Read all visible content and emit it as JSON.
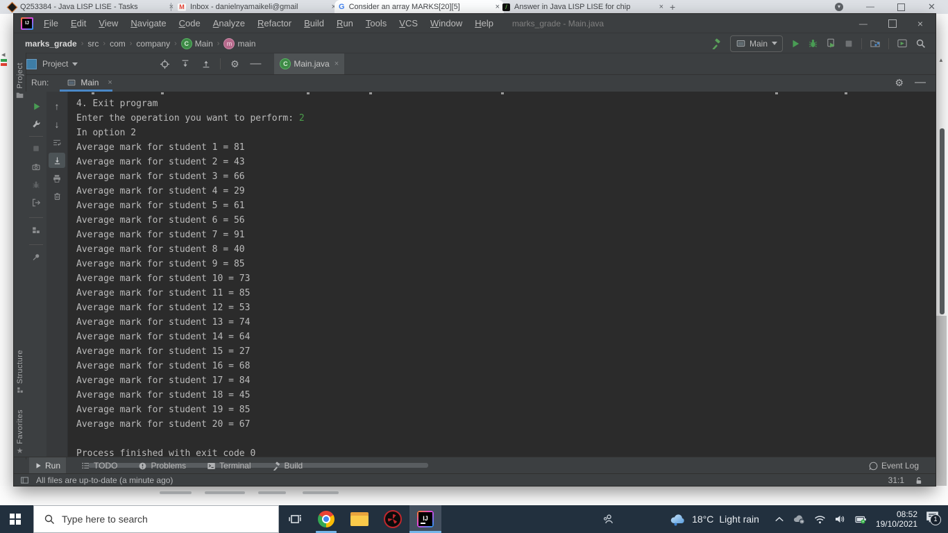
{
  "colors": {
    "accent_blue": "#4A88C7",
    "run_green": "#499C54",
    "console_input_green": "#4B9E4B",
    "ide_chrome": "#3C3F41",
    "console_bg": "#2B2B2B",
    "taskbar_bg": "#22303E"
  },
  "browser": {
    "tabs": [
      {
        "title": "Q253384 - Java LISP LISE - Tasks"
      },
      {
        "title": "Inbox - danielnyamaikeli@gmail"
      },
      {
        "title": "Consider an array MARKS[20][5]"
      },
      {
        "title": "Answer in Java LISP LISE for chip"
      }
    ],
    "close_glyph": "×",
    "new_tab_glyph": "+"
  },
  "ide": {
    "window_title": "marks_grade - Main.java",
    "menu_items": [
      "File",
      "Edit",
      "View",
      "Navigate",
      "Code",
      "Analyze",
      "Refactor",
      "Build",
      "Run",
      "Tools",
      "VCS",
      "Window",
      "Help"
    ],
    "breadcrumbs": {
      "project": "marks_grade",
      "items": [
        "src",
        "com",
        "company"
      ],
      "class_name": "Main",
      "method_name": "main"
    },
    "toolbar": {
      "run_config": "Main"
    },
    "project_panel": {
      "label": "Project"
    },
    "editor_tabs": [
      {
        "label": "Main.java"
      }
    ],
    "left_stripe": {
      "project": "Project",
      "structure": "Structure",
      "favorites": "Favorites"
    },
    "run_panel": {
      "label": "Run:",
      "tab": "Main",
      "console_lines": [
        [
          {
            "t": "4. Exit program"
          }
        ],
        [
          {
            "t": "Enter the operation you want to perform: "
          },
          {
            "t": "2",
            "c": "input"
          }
        ],
        [
          {
            "t": "In option 2"
          }
        ],
        [
          {
            "t": "Average mark for student 1 = 81"
          }
        ],
        [
          {
            "t": "Average mark for student 2 = 43"
          }
        ],
        [
          {
            "t": "Average mark for student 3 = 66"
          }
        ],
        [
          {
            "t": "Average mark for student 4 = 29"
          }
        ],
        [
          {
            "t": "Average mark for student 5 = 61"
          }
        ],
        [
          {
            "t": "Average mark for student 6 = 56"
          }
        ],
        [
          {
            "t": "Average mark for student 7 = 91"
          }
        ],
        [
          {
            "t": "Average mark for student 8 = 40"
          }
        ],
        [
          {
            "t": "Average mark for student 9 = 85"
          }
        ],
        [
          {
            "t": "Average mark for student 10 = 73"
          }
        ],
        [
          {
            "t": "Average mark for student 11 = 85"
          }
        ],
        [
          {
            "t": "Average mark for student 12 = 53"
          }
        ],
        [
          {
            "t": "Average mark for student 13 = 74"
          }
        ],
        [
          {
            "t": "Average mark for student 14 = 64"
          }
        ],
        [
          {
            "t": "Average mark for student 15 = 27"
          }
        ],
        [
          {
            "t": "Average mark for student 16 = 68"
          }
        ],
        [
          {
            "t": "Average mark for student 17 = 84"
          }
        ],
        [
          {
            "t": "Average mark for student 18 = 45"
          }
        ],
        [
          {
            "t": "Average mark for student 19 = 85"
          }
        ],
        [
          {
            "t": "Average mark for student 20 = 67"
          }
        ],
        [
          {
            "t": ""
          }
        ],
        [
          {
            "t": "Process finished with exit code 0"
          }
        ]
      ]
    },
    "tool_buttons": [
      "Run",
      "TODO",
      "Problems",
      "Terminal",
      "Build"
    ],
    "event_log": "Event Log",
    "status_bar": {
      "message": "All files are up-to-date (a minute ago)",
      "caret_position": "31:1"
    }
  },
  "taskbar": {
    "search_placeholder": "Type here to search",
    "weather_temp": "18°C",
    "weather_desc": "Light rain",
    "time": "08:52",
    "date": "19/10/2021",
    "notification_count": "1"
  }
}
